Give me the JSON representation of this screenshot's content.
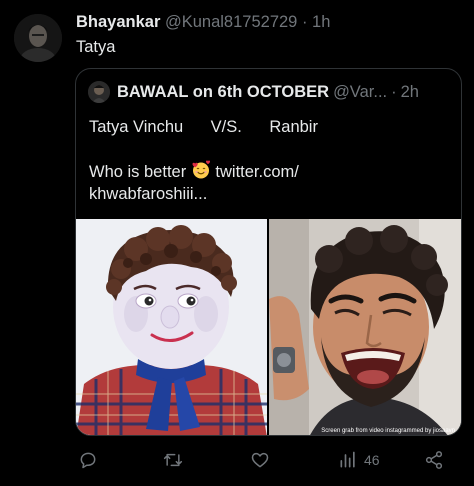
{
  "tweet": {
    "author_name": "Bhayankar",
    "author_handle": "@Kunal81752729",
    "separator": "·",
    "time": "1h",
    "text": "Tatya"
  },
  "quoted_tweet": {
    "author_name": "BAWAAL on 6th OCTOBER",
    "author_handle": "@Var...",
    "separator": "·",
    "time": "2h",
    "line1": "Tatya Vinchu      V/S.      Ranbir",
    "line2_prefix": "Who is better",
    "line2_link": " twitter.com/",
    "line3_link": "khwabfaroshiii...",
    "emoji": "smiling-face-with-hearts",
    "media_caption": "Screen grab from video instagrammed by jiosaavn"
  },
  "actions": {
    "reply": "",
    "retweet": "",
    "like": "",
    "views_count": "46",
    "share": ""
  },
  "colors": {
    "background": "#000000",
    "text": "#e7e9ea",
    "muted": "#71767b",
    "border": "#2f3336"
  }
}
